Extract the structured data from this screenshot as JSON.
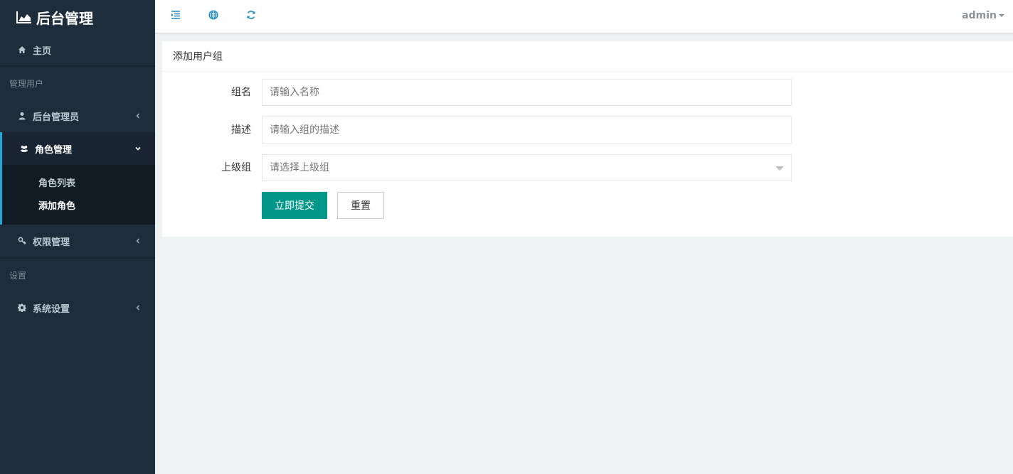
{
  "sidebar": {
    "brand": {
      "title": "后台管理",
      "icon": "area-chart-icon"
    },
    "home": {
      "label": "主页",
      "icon": "home-icon"
    },
    "sections": [
      {
        "label": "管理用户"
      },
      {
        "label": "设置"
      }
    ],
    "items": [
      {
        "label": "后台管理员",
        "icon": "user-icon"
      },
      {
        "label": "角色管理",
        "icon": "users-icon",
        "expanded": true
      },
      {
        "label": "权限管理",
        "icon": "key-icon"
      },
      {
        "label": "系统设置",
        "icon": "gear-icon"
      }
    ],
    "submenu": [
      {
        "label": "角色列表",
        "active": false
      },
      {
        "label": "添加角色",
        "active": true
      }
    ],
    "colors": {
      "background": "#1e2d3c",
      "active_border": "#1ba9d6"
    }
  },
  "topbar": {
    "icons": [
      "indent-icon",
      "globe-icon",
      "refresh-icon"
    ],
    "user": "admin"
  },
  "form": {
    "title": "添加用户组",
    "fields": [
      {
        "label": "组名",
        "placeholder": "请输入名称"
      },
      {
        "label": "描述",
        "placeholder": "请输入组的描述"
      },
      {
        "label": "上级组",
        "placeholder": "请选择上级组"
      }
    ],
    "submit_label": "立即提交",
    "reset_label": "重置",
    "colors": {
      "primary": "#009688"
    }
  }
}
